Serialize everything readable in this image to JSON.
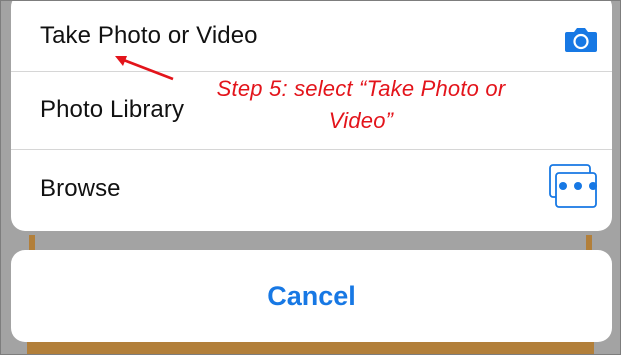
{
  "action_sheet": {
    "items": [
      {
        "label": "Take Photo or Video",
        "icon": "camera-icon"
      },
      {
        "label": "Photo Library",
        "icon": "photo-library-icon"
      },
      {
        "label": "Browse",
        "icon": "more-dots-icon"
      }
    ],
    "cancel_label": "Cancel"
  },
  "annotation": {
    "line1": "Step 5: select “Take Photo or",
    "line2": "Video”"
  },
  "colors": {
    "accent": "#1778e4",
    "annotation": "#e3141b",
    "backdrop": "#a3a3a3"
  }
}
